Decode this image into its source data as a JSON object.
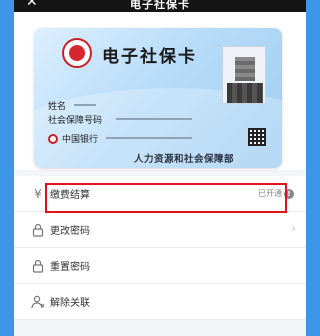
{
  "header": {
    "title": "电子社保卡",
    "back": "✕"
  },
  "card": {
    "title": "电子社保卡",
    "name_label": "姓名",
    "ssn_label": "社会保障号码",
    "bank": "中国银行",
    "ministry": "人力资源和社会保障部"
  },
  "menu": {
    "items": [
      {
        "label": "缴费结算",
        "status": "已开通",
        "info": "!"
      },
      {
        "label": "更改密码",
        "chevron": "›"
      },
      {
        "label": "重置密码"
      },
      {
        "label": "解除关联"
      }
    ]
  },
  "colors": {
    "accent": "#3d96e8",
    "highlight": "#e0121b"
  }
}
